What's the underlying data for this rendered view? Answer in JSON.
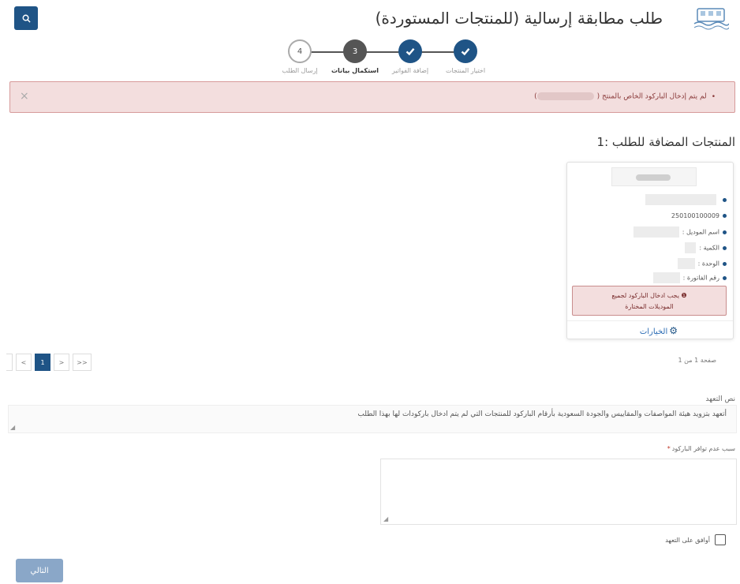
{
  "header": {
    "title": "طلب مطابقة إرسالية (للمنتجات المستوردة)",
    "search_icon": "search-icon",
    "logo_icon": "ministry-logo-icon"
  },
  "stepper": {
    "steps": [
      {
        "number": "",
        "label": "اختيار المنتجات",
        "state": "done"
      },
      {
        "number": "",
        "label": "إضافة الفواتير",
        "state": "done"
      },
      {
        "number": "3",
        "label": "استكمال بيانات",
        "state": "active"
      },
      {
        "number": "4",
        "label": "إرسال الطلب",
        "state": "todo"
      }
    ]
  },
  "alert": {
    "message": "لم يتم إدخال الباركود الخاص بالمنتج (",
    "closing": ")",
    "close_glyph": "×"
  },
  "products": {
    "title": "المنتجات المضافة للطلب :1"
  },
  "card": {
    "barcode": "250100100009",
    "model_name_label": "اسم الموديل :",
    "quantity_label": "الكمية :",
    "unit_label": "الوحدة :",
    "invoice_label": "رقم الفاتورة :",
    "error_line1": "يجب ادخال الباركود لجميع",
    "error_line2": "الموديلات المختارة",
    "error_glyph": "❶",
    "options_label": "الخيارات",
    "options_icon": "gears-icon"
  },
  "pagination": {
    "info": "صفحة 1 من 1",
    "first": "<<",
    "prev": "<",
    "current": "1",
    "next": ">",
    "last": ">>"
  },
  "pledge": {
    "label": "نص التعهد",
    "text": "أتعهد بتزويد هيئة المواصفات والمقاييس والجودة السعودية بأرقام الباركود للمنتجات التي لم يتم ادخال باركودات لها بهذا الطلب"
  },
  "reason": {
    "label": "سبب عدم توافر الباركود",
    "required_mark": "*",
    "value": ""
  },
  "agree": {
    "label": "أوافق على التعهد"
  },
  "next_button": {
    "label": "التالي"
  },
  "colors": {
    "primary": "#1f5486",
    "alert_bg": "#f3dede",
    "alert_border": "#d79a9a",
    "link": "#2a6bb4",
    "button_disabled": "#8aa7c8"
  }
}
